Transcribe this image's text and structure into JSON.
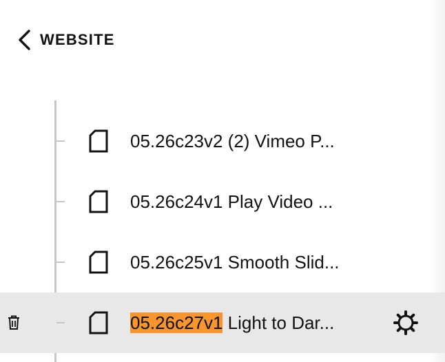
{
  "header": {
    "back_label": "WEBSITE"
  },
  "pages": [
    {
      "highlight": "",
      "label": "05.26c23v2 (2) Vimeo P...",
      "selected": false
    },
    {
      "highlight": "",
      "label": "05.26c24v1 Play Video ...",
      "selected": false
    },
    {
      "highlight": "",
      "label": "05.26c25v1 Smooth Slid...",
      "selected": false
    },
    {
      "highlight": "05.26c27v1",
      "label": " Light to Dar...",
      "selected": true
    }
  ],
  "colors": {
    "highlight": "#f7962f",
    "selected_row": "#e8e8e8",
    "tree_line": "#c7c7c7"
  },
  "icons": {
    "back": "chevron-left-icon",
    "page": "file-icon",
    "delete": "trash-icon",
    "settings": "gear-icon"
  }
}
